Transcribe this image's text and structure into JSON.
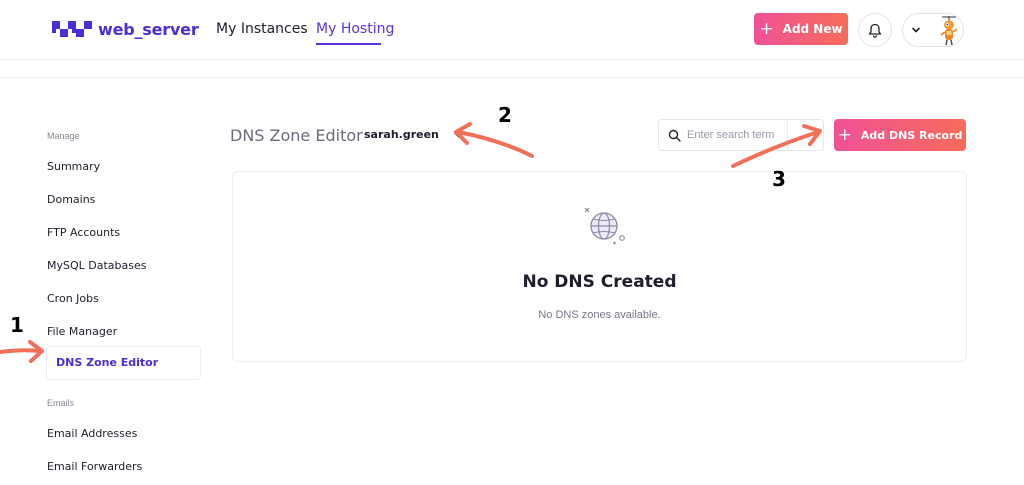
{
  "header": {
    "logo_text": "web_server",
    "nav": [
      {
        "label": "My Instances"
      },
      {
        "label": "My Hosting"
      }
    ],
    "add_new_label": "Add New"
  },
  "sidebar": {
    "sections": [
      {
        "title": "Manage",
        "items": [
          "Summary",
          "Domains",
          "FTP Accounts",
          "MySQL Databases",
          "Cron Jobs",
          "File Manager",
          "DNS Zone Editor"
        ]
      },
      {
        "title": "Emails",
        "items": [
          "Email Addresses",
          "Email Forwarders"
        ]
      }
    ],
    "active_item": "DNS Zone Editor"
  },
  "main": {
    "title": "DNS Zone Editor",
    "account_selected": "sarah.green",
    "search_placeholder": "Enter search term",
    "add_dns_label": "Add DNS Record",
    "empty_title": "No DNS Created",
    "empty_subtitle": "No DNS zones available."
  },
  "annotations": {
    "markers": [
      "1",
      "2",
      "3"
    ],
    "arrow_color": "#f2705a"
  },
  "colors": {
    "brand": "#4b2fd6",
    "accent_gradient_start": "#f05196",
    "accent_gradient_end": "#f76c5b"
  }
}
